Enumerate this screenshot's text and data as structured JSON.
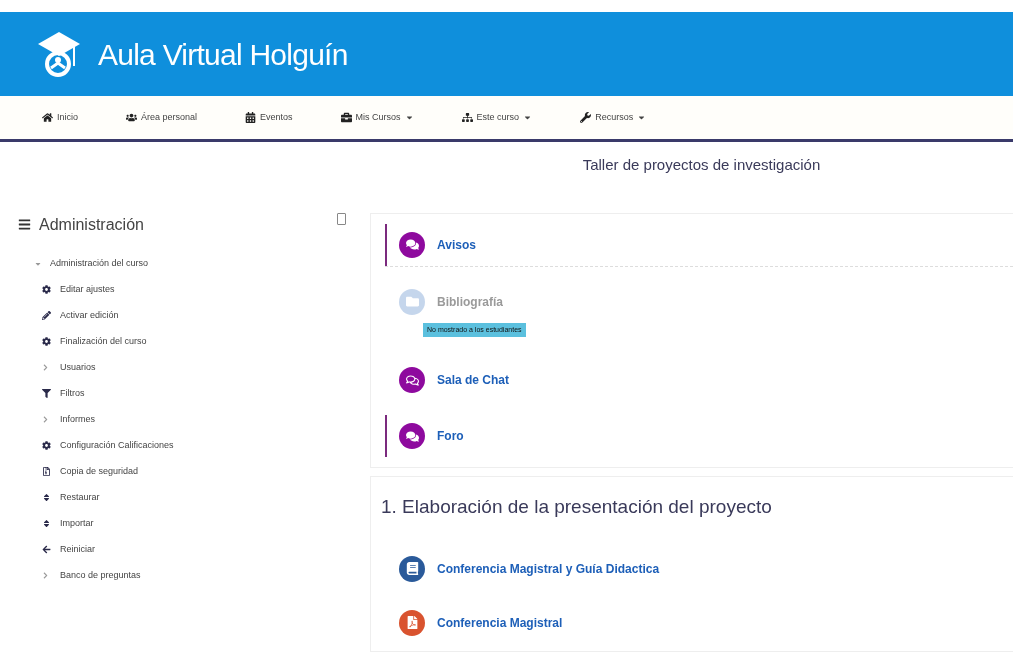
{
  "header": {
    "title": "Aula Virtual Holguín"
  },
  "nav": [
    {
      "label": "Inicio",
      "kind": "home",
      "dropdown": false
    },
    {
      "label": "Área personal",
      "kind": "users",
      "dropdown": false
    },
    {
      "label": "Eventos",
      "kind": "calendar",
      "dropdown": false
    },
    {
      "label": "Mis Cursos",
      "kind": "briefcase",
      "dropdown": true
    },
    {
      "label": "Este curso",
      "kind": "sitemap",
      "dropdown": true
    },
    {
      "label": "Recursos",
      "kind": "wrench",
      "dropdown": true
    }
  ],
  "page_title": "Taller de proyectos de investigación",
  "sidebar": {
    "title": "Administración",
    "items": [
      {
        "label": "Administración del curso",
        "expanded": true,
        "children": [
          {
            "label": "Editar ajustes",
            "kind": "gear"
          },
          {
            "label": "Activar edición",
            "kind": "pencil"
          },
          {
            "label": "Finalización del curso",
            "kind": "gear"
          },
          {
            "label": "Usuarios",
            "kind": "branch",
            "expanded": false
          },
          {
            "label": "Filtros",
            "kind": "filter"
          },
          {
            "label": "Informes",
            "kind": "branch",
            "expanded": false
          },
          {
            "label": "Configuración Calificaciones",
            "kind": "gear"
          },
          {
            "label": "Copia de seguridad",
            "kind": "file"
          },
          {
            "label": "Restaurar",
            "kind": "updown"
          },
          {
            "label": "Importar",
            "kind": "updown"
          },
          {
            "label": "Reiniciar",
            "kind": "reset"
          },
          {
            "label": "Banco de preguntas",
            "kind": "branch",
            "expanded": false
          }
        ]
      }
    ]
  },
  "general_activities": [
    {
      "label": "Avisos",
      "kind": "forum",
      "highlighted": true,
      "dimmed": false
    },
    {
      "label": "Bibliografía",
      "kind": "folder",
      "highlighted": false,
      "dimmed": true,
      "badge": "No mostrado a los estudiantes"
    },
    {
      "label": "Sala de Chat",
      "kind": "chat",
      "highlighted": false,
      "dimmed": false
    },
    {
      "label": "Foro",
      "kind": "forum",
      "highlighted": true,
      "dimmed": false
    }
  ],
  "section": {
    "title": "1. Elaboración de la presentación del proyecto",
    "activities": [
      {
        "label": "Conferencia Magistral y Guía Didactica",
        "kind": "book",
        "highlighted": false,
        "dimmed": false
      },
      {
        "label": "Conferencia Magistral",
        "kind": "pdf",
        "highlighted": false,
        "dimmed": false
      }
    ]
  }
}
